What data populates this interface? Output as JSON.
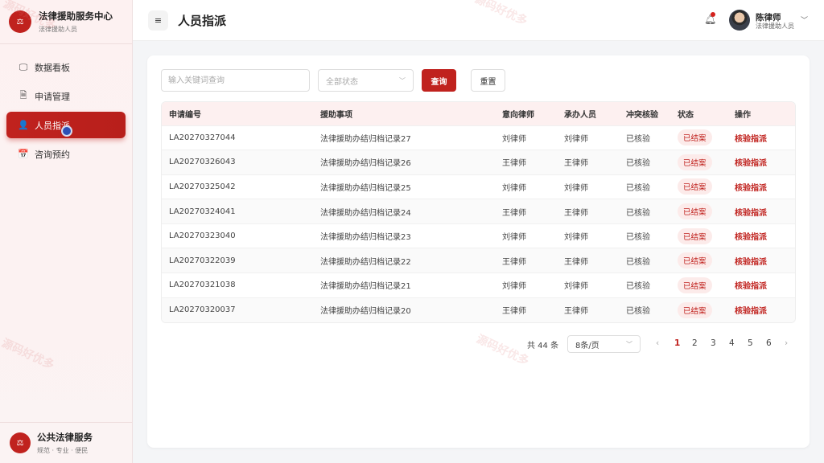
{
  "brand": {
    "logo": "⚖",
    "title": "法律援助服务中心",
    "subtitle": "法律援助人员"
  },
  "nav": [
    {
      "label": "数据看板",
      "icon": "monitor-icon",
      "glyph": "🖵",
      "active": false
    },
    {
      "label": "申请管理",
      "icon": "document-icon",
      "glyph": "🗎",
      "active": false
    },
    {
      "label": "人员指派",
      "icon": "user-icon",
      "glyph": "👤",
      "active": true
    },
    {
      "label": "咨询预约",
      "icon": "calendar-icon",
      "glyph": "📅",
      "active": false
    }
  ],
  "footer": {
    "logo": "⚖",
    "title": "公共法律服务",
    "subtitle": "规范 · 专业 · 便民"
  },
  "header": {
    "title": "人员指派",
    "menu_glyph": "≡",
    "user_name": "陈律师",
    "user_role": "法律援助人员"
  },
  "filters": {
    "search_placeholder": "输入关键词查询",
    "status_placeholder": "全部状态",
    "query_label": "查询",
    "reset_label": "重置"
  },
  "table": {
    "columns": [
      "申请编号",
      "援助事项",
      "意向律师",
      "承办人员",
      "冲突核验",
      "状态",
      "操作"
    ],
    "rows": [
      [
        "LA20270327044",
        "法律援助办结归档记录27",
        "刘律师",
        "刘律师",
        "已核验",
        "已结案",
        "核验指派"
      ],
      [
        "LA20270326043",
        "法律援助办结归档记录26",
        "王律师",
        "王律师",
        "已核验",
        "已结案",
        "核验指派"
      ],
      [
        "LA20270325042",
        "法律援助办结归档记录25",
        "刘律师",
        "刘律师",
        "已核验",
        "已结案",
        "核验指派"
      ],
      [
        "LA20270324041",
        "法律援助办结归档记录24",
        "王律师",
        "王律师",
        "已核验",
        "已结案",
        "核验指派"
      ],
      [
        "LA20270323040",
        "法律援助办结归档记录23",
        "刘律师",
        "刘律师",
        "已核验",
        "已结案",
        "核验指派"
      ],
      [
        "LA20270322039",
        "法律援助办结归档记录22",
        "王律师",
        "王律师",
        "已核验",
        "已结案",
        "核验指派"
      ],
      [
        "LA20270321038",
        "法律援助办结归档记录21",
        "刘律师",
        "刘律师",
        "已核验",
        "已结案",
        "核验指派"
      ],
      [
        "LA20270320037",
        "法律援助办结归档记录20",
        "王律师",
        "王律师",
        "已核验",
        "已结案",
        "核验指派"
      ]
    ]
  },
  "pagination": {
    "total": "共 44 条",
    "page_size": "8条/页",
    "pages": [
      "1",
      "2",
      "3",
      "4",
      "5",
      "6"
    ],
    "current": "1",
    "prev": "‹",
    "next": "›"
  },
  "watermark": "源码好优多",
  "colors": {
    "accent": "#c0221e",
    "sidebar_bg": "#fdf1f1",
    "header_row_bg": "#fdf0f0"
  }
}
